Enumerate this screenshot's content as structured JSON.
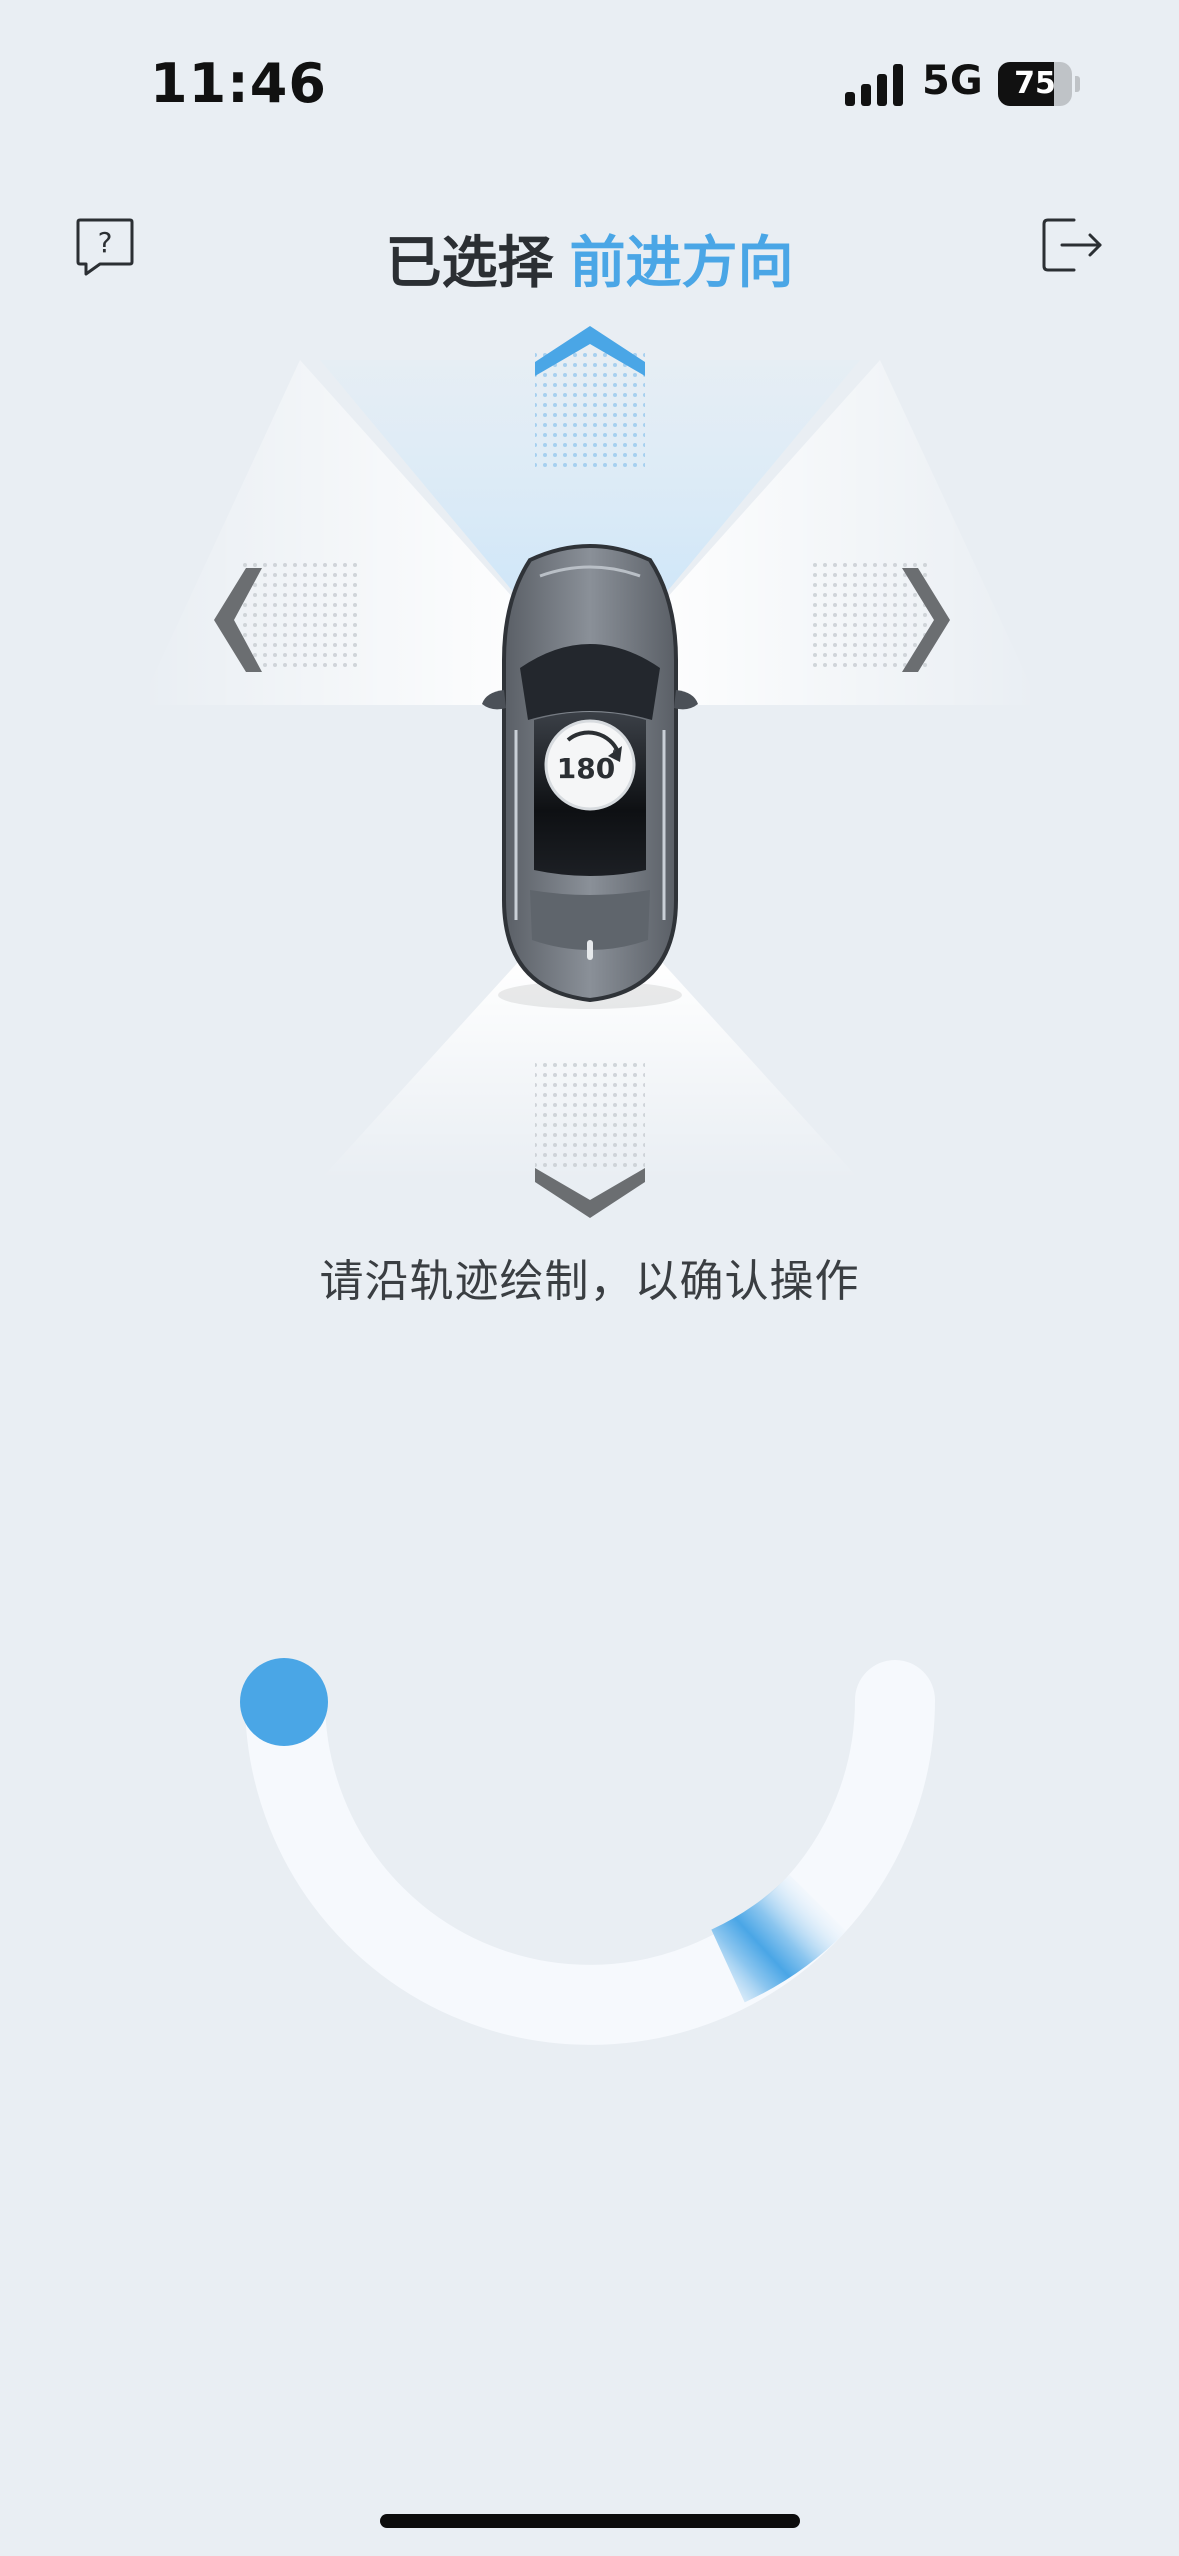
{
  "status_bar": {
    "time": "11:46",
    "network": "5G",
    "battery_percent": "75",
    "signal_icon": "cellular-signal-icon"
  },
  "header": {
    "help_icon": "help-question-icon",
    "exit_icon": "exit-logout-icon",
    "title_prefix": "已选择",
    "title_selection": "前进方向"
  },
  "direction_control": {
    "selected": "forward",
    "rotation_label": "180",
    "rotation_degree_mark": "°",
    "icons": [
      "up-arrow-icon",
      "down-arrow-icon",
      "left-arrow-icon",
      "right-arrow-icon",
      "rotate-180-icon",
      "car-topview-icon"
    ]
  },
  "instruction": {
    "text": "请沿轨迹绘制，以确认操作"
  },
  "gesture": {
    "handle_icon": "drag-handle-icon",
    "progress": 0
  },
  "colors": {
    "background": "#e9eef3",
    "accent": "#4aa6e6",
    "arrow_inactive": "#6b6e71",
    "text_primary": "#2b2f33",
    "track": "#f6f9fd"
  }
}
